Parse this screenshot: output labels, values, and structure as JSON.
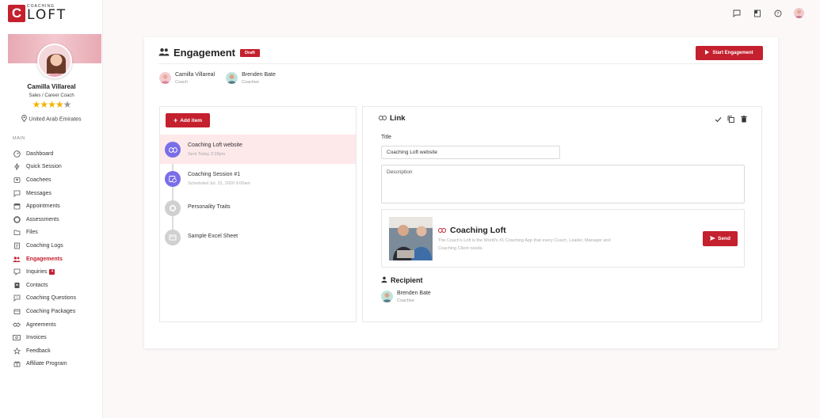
{
  "brand": {
    "logo_letter": "C",
    "logo_small": "COACHING",
    "logo_big": "LOFT",
    "accent": "#c4202e"
  },
  "profile": {
    "name": "Camilla Villareal",
    "title": "Sales / Career Coach",
    "rating": 4.5,
    "location": "United Arab Emirates"
  },
  "sidebar": {
    "section_label": "MAIN",
    "items": [
      {
        "label": "Dashboard",
        "icon": "dashboard-icon"
      },
      {
        "label": "Quick Session",
        "icon": "bolt-icon"
      },
      {
        "label": "Coachees",
        "icon": "coachees-icon"
      },
      {
        "label": "Messages",
        "icon": "message-icon"
      },
      {
        "label": "Appointments",
        "icon": "calendar-icon"
      },
      {
        "label": "Assessments",
        "icon": "assessment-icon"
      },
      {
        "label": "Files",
        "icon": "folder-icon"
      },
      {
        "label": "Coaching Logs",
        "icon": "log-icon"
      },
      {
        "label": "Engagements",
        "icon": "engagement-icon",
        "active": true
      },
      {
        "label": "Inquiries",
        "icon": "inquiry-icon",
        "badge": "4"
      },
      {
        "label": "Contacts",
        "icon": "contact-icon"
      },
      {
        "label": "Coaching Questions",
        "icon": "question-icon"
      },
      {
        "label": "Coaching Packages",
        "icon": "package-icon"
      },
      {
        "label": "Agreements",
        "icon": "handshake-icon"
      },
      {
        "label": "Invoices",
        "icon": "invoice-icon"
      },
      {
        "label": "Feedback",
        "icon": "star-icon"
      },
      {
        "label": "Affiliate Program",
        "icon": "gift-icon"
      }
    ]
  },
  "engagement": {
    "title": "Engagement",
    "status": "Draft",
    "start_label": "Start Engagement",
    "participants": [
      {
        "name": "Camilla Villareal",
        "role": "Coach"
      },
      {
        "name": "Brenden Bate",
        "role": "Coachee"
      }
    ]
  },
  "items_panel": {
    "add_label": "Add item",
    "items": [
      {
        "title": "Coaching Loft website",
        "sub": "Sent Today 2:28pm"
      },
      {
        "title": "Coaching Session #1",
        "sub": "Scheduled Jul. 31, 2020 9:00am"
      },
      {
        "title": "Personality Traits",
        "sub": ""
      },
      {
        "title": "Sample Excel Sheet",
        "sub": ""
      }
    ]
  },
  "detail": {
    "heading": "Link",
    "title_label": "Title",
    "title_value": "Coaching Loft website",
    "description_placeholder": "Description",
    "preview_title": "Coaching Loft",
    "preview_desc": "The Coach's Loft is the World's #1 Coaching App that every Coach, Leader, Manager and Coaching Client needs.",
    "send_label": "Send",
    "recipient_heading": "Recipient",
    "recipient": {
      "name": "Brenden Bate",
      "role": "Coachee"
    }
  }
}
